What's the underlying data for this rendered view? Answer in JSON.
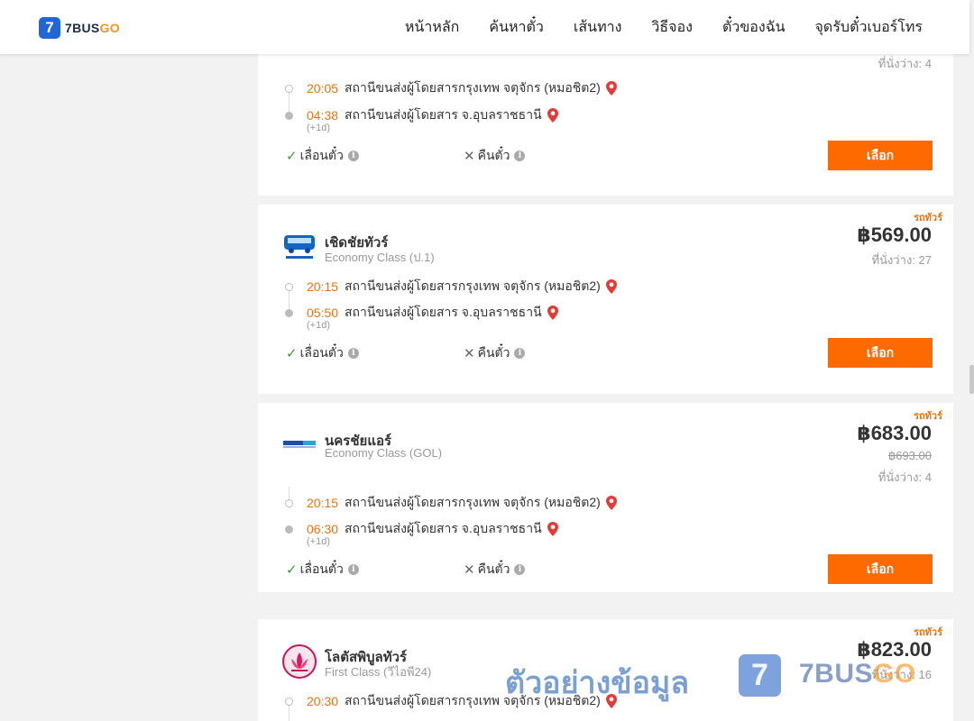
{
  "header": {
    "logo_mark": "7",
    "logo_text_a": "7BUS",
    "logo_text_b": "GO",
    "nav": [
      "หน้าหลัก",
      "ค้นหาตั๋ว",
      "เส้นทาง",
      "วิธีจอง",
      "ตั๋วของฉัน",
      "จุดรับตั๋วเบอร์โทร"
    ]
  },
  "trips": [
    {
      "seats": "ที่นั่งว่าง: 4",
      "depart_time": "20:05",
      "depart_place": "สถานีขนส่งผู้โดยสารกรุงเทพ จตุจักร (หมอชิต2)",
      "arrive_time": "04:38",
      "arrive_place": "สถานีขนส่งผู้โดยสาร จ.อุบลราชธานี",
      "next_day": "(+1d)",
      "reschedule": "เลื่อนตั๋ว",
      "refund": "คืนตั๋ว",
      "select": "เลือก"
    },
    {
      "badge": "รถทัวร์",
      "operator": "เชิดชัยทัวร์",
      "class": "Economy Class (ป.1)",
      "price": "฿569.00",
      "seats": "ที่นั่งว่าง: 27",
      "depart_time": "20:15",
      "depart_place": "สถานีขนส่งผู้โดยสารกรุงเทพ จตุจักร (หมอชิต2)",
      "arrive_time": "05:50",
      "arrive_place": "สถานีขนส่งผู้โดยสาร จ.อุบลราชธานี",
      "next_day": "(+1d)",
      "reschedule": "เลื่อนตั๋ว",
      "refund": "คืนตั๋ว",
      "select": "เลือก"
    },
    {
      "badge": "รถทัวร์",
      "operator": "นครชัยแอร์",
      "class": "Economy Class (GOL)",
      "price": "฿683.00",
      "old_price": "฿693.00",
      "seats": "ที่นั่งว่าง: 4",
      "depart_time": "20:15",
      "depart_place": "สถานีขนส่งผู้โดยสารกรุงเทพ จตุจักร (หมอชิต2)",
      "arrive_time": "06:30",
      "arrive_place": "สถานีขนส่งผู้โดยสาร จ.อุบลราชธานี",
      "next_day": "(+1d)",
      "reschedule": "เลื่อนตั๋ว",
      "refund": "คืนตั๋ว",
      "select": "เลือก"
    },
    {
      "badge": "รถทัวร์",
      "operator": "โลตัสพิบูลทัวร์",
      "class": "First Class (วีไอพี24)",
      "price": "฿823.00",
      "seats": "ที่นั่งว่าง: 16",
      "depart_time": "20:30",
      "depart_place": "สถานีขนส่งผู้โดยสารกรุงเทพ จตุจักร (หมอชิต2)"
    }
  ],
  "watermark": {
    "text": "ตัวอย่างข้อมูล",
    "mark": "7",
    "brand_a": "7BUS",
    "brand_b": "GO"
  },
  "colors": {
    "accent": "#ff6a00",
    "time": "#e8740e",
    "logo_blue": "#1f66d6"
  }
}
